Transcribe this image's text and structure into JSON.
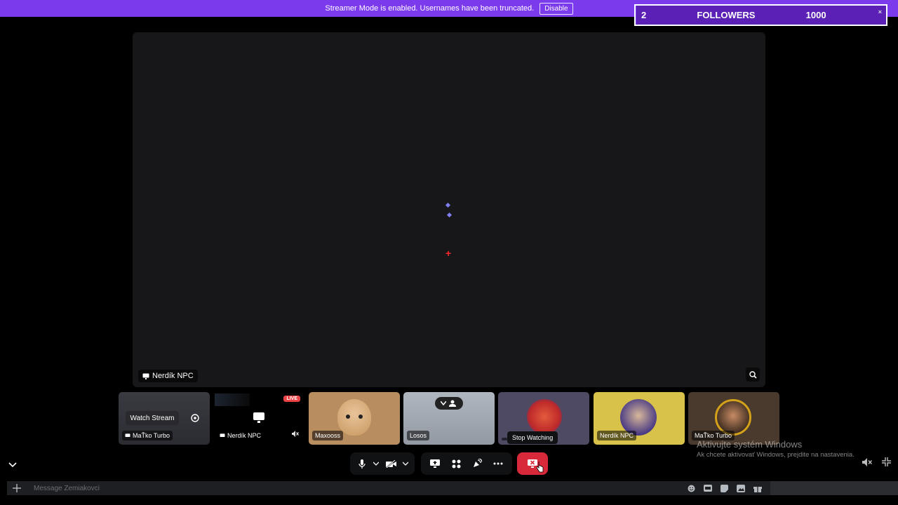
{
  "banner": {
    "text": "Streamer Mode is enabled. Usernames have been truncated.",
    "disable_label": "Disable"
  },
  "followers_goal": {
    "current": "2",
    "label": "FOLLOWERS",
    "target": "1000",
    "close_glyph": "×",
    "progress_fraction": 0.002
  },
  "stage": {
    "streamer_name": "Nerdík NPC"
  },
  "tiles": [
    {
      "name": "MaŤko Turbo",
      "action": "Watch Stream",
      "type": "stream"
    },
    {
      "name": "Nerdík NPC",
      "badge": "LIVE",
      "type": "stream-live"
    },
    {
      "name": "Maxooss",
      "type": "avatar"
    },
    {
      "name": "Losos",
      "type": "video"
    },
    {
      "name": "",
      "type": "avatar"
    },
    {
      "name": "Nerdík NPC",
      "type": "avatar"
    },
    {
      "name": "MaŤko Turbo",
      "type": "avatar"
    }
  ],
  "tooltip": "Stop Watching",
  "watermark": {
    "title": "Aktivujte systém Windows",
    "subtitle": "Ak chcete aktivovať Windows, prejdite na nastavenia."
  },
  "message": {
    "placeholder": "Message Zemiakovci"
  },
  "icons": {
    "mic": "microphone-icon",
    "camera": "camera-off-icon",
    "share": "screen-share-icon",
    "activities": "activities-icon",
    "soundboard": "soundboard-icon",
    "more": "more-icon",
    "stop": "stop-watching-icon",
    "zoom": "zoom-icon",
    "fullscreen": "exit-fullscreen-icon",
    "volume": "volume-mute-icon"
  },
  "colors": {
    "banner": "#7c3aed",
    "stop": "#d8293b",
    "live": "#ed4245",
    "accent": "#7f7ff0"
  }
}
